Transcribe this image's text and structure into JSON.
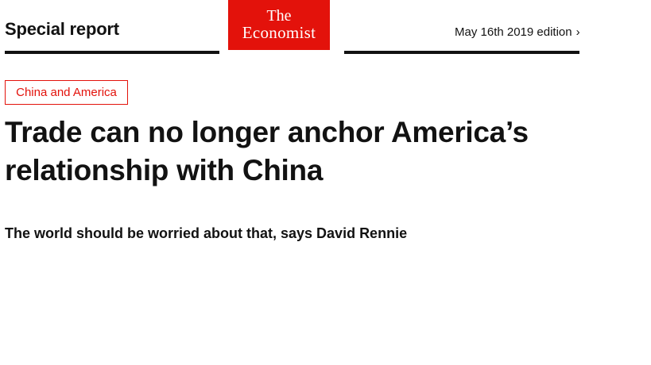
{
  "header": {
    "section_title": "Special report",
    "logo": {
      "line1": "The",
      "line2": "Economist",
      "background_color": "#e3120b",
      "text_color": "#ffffff"
    },
    "edition_label": "May 16th 2019 edition",
    "edition_chevron": "›"
  },
  "article": {
    "tag": "China and America",
    "headline": "Trade can no longer anchor America’s relationship with China",
    "subheadline": "The world should be worried about that, says David Rennie"
  },
  "colors": {
    "accent": "#e3120b",
    "text": "#121212",
    "rule": "#121212"
  }
}
